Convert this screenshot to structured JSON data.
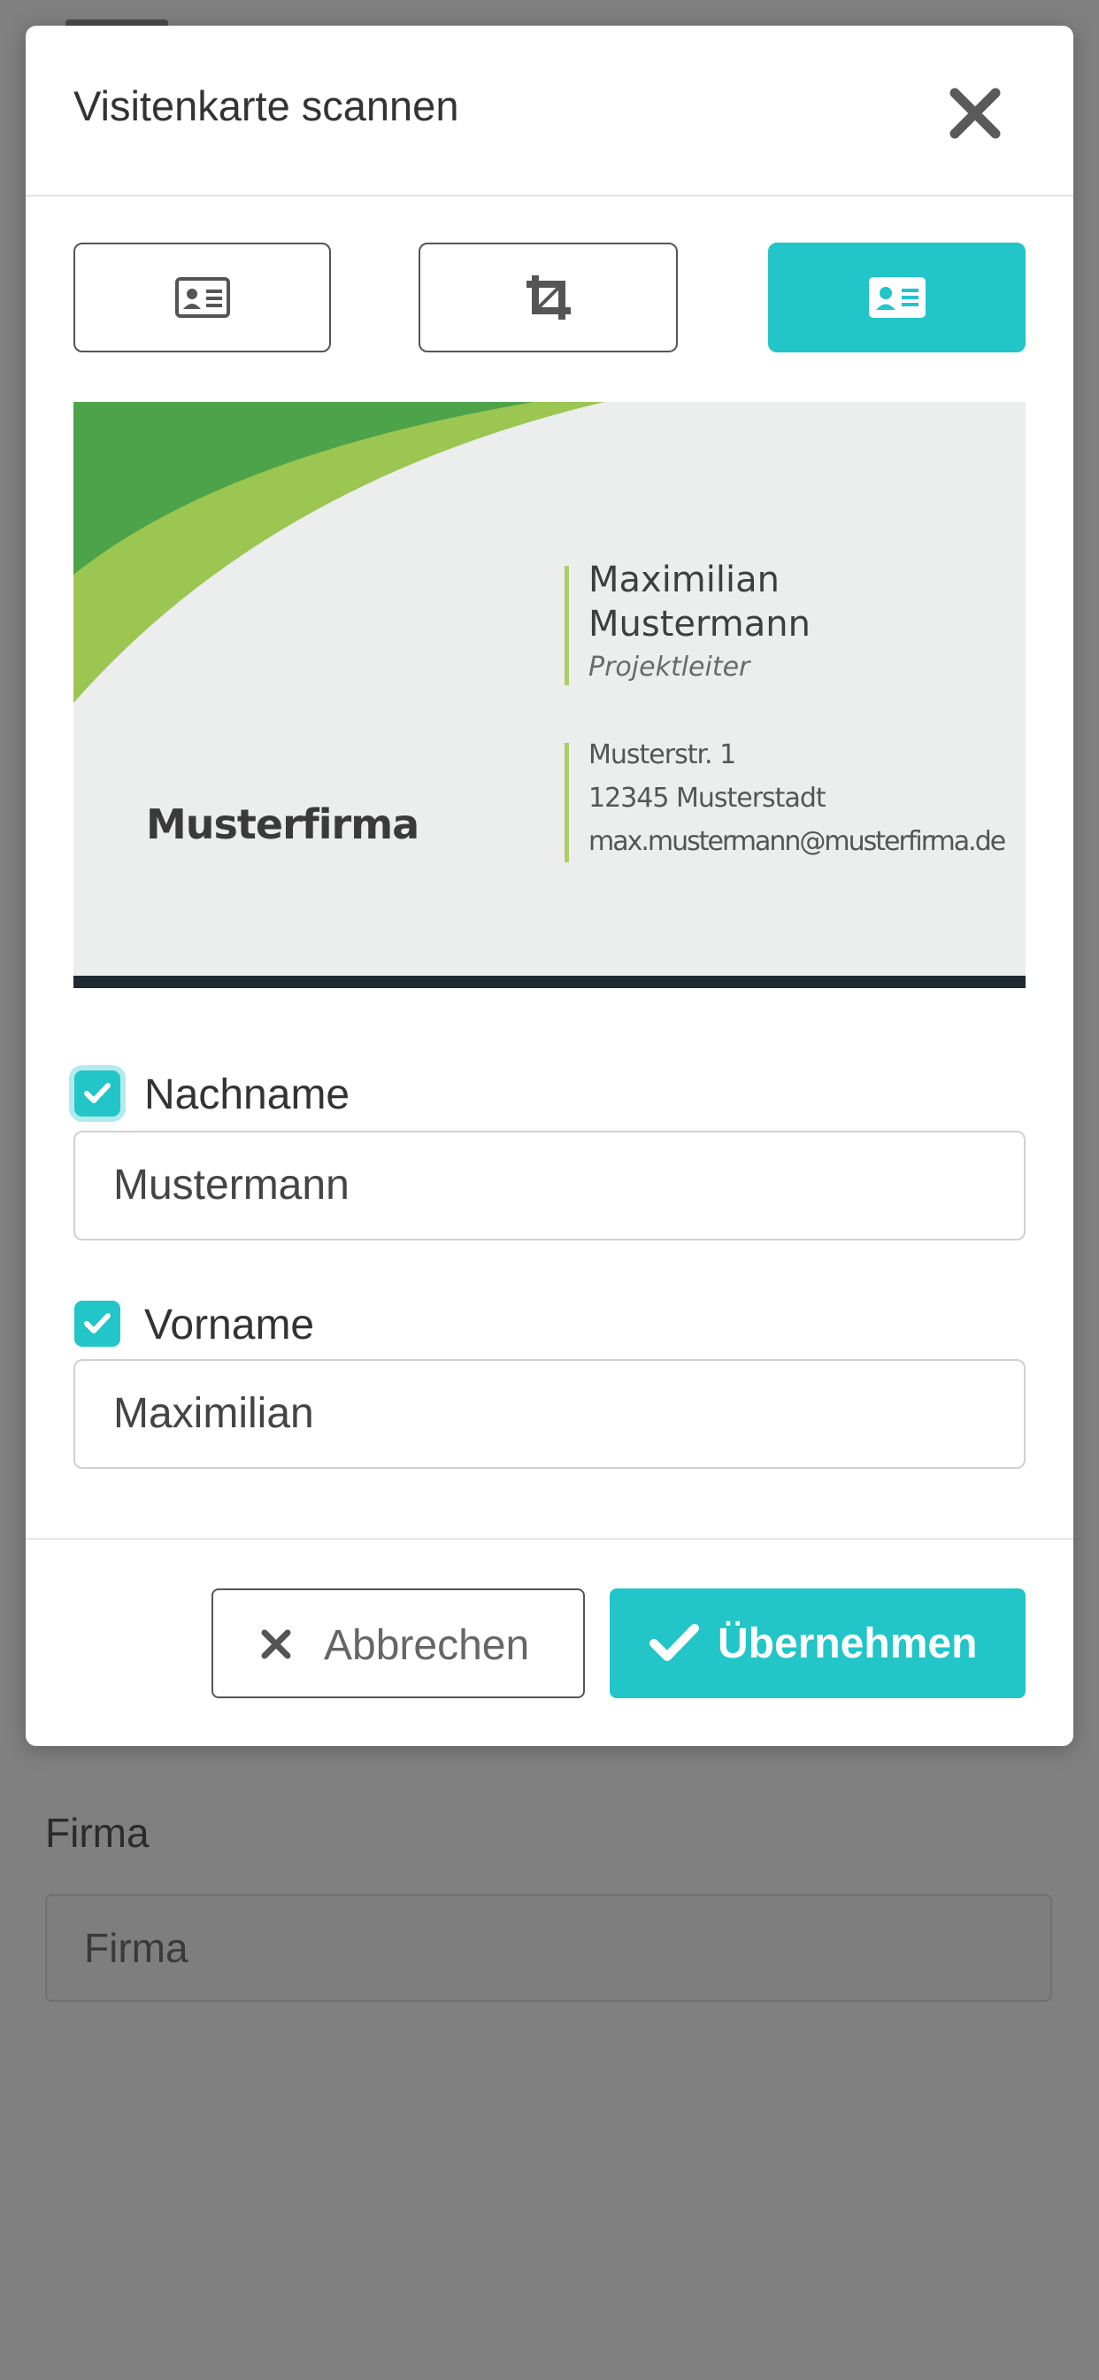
{
  "background": {
    "firma_label": "Firma",
    "firma_placeholder": "Firma"
  },
  "modal": {
    "title": "Visitenkarte scannen",
    "close_icon": "close-icon",
    "steps": [
      {
        "icon": "id-card-icon",
        "active": false
      },
      {
        "icon": "crop-icon",
        "active": false
      },
      {
        "icon": "id-card-icon",
        "active": true
      }
    ],
    "card": {
      "company": "Musterfirma",
      "first_name": "Maximilian",
      "last_name": "Mustermann",
      "role": "Projektleiter",
      "street": "Musterstr. 1",
      "city": "12345 Musterstadt",
      "email": "max.mustermann@musterfirma.de"
    },
    "fields": [
      {
        "label": "Nachname",
        "value": "Mustermann",
        "checked": true
      },
      {
        "label": "Vorname",
        "value": "Maximilian",
        "checked": true
      }
    ],
    "cancel_label": "Abbrechen",
    "confirm_label": "Übernehmen"
  },
  "colors": {
    "accent": "#22c5c8",
    "overlay": "#808080",
    "card_green_dark": "#4da34a",
    "card_green_light": "#9bc652"
  }
}
